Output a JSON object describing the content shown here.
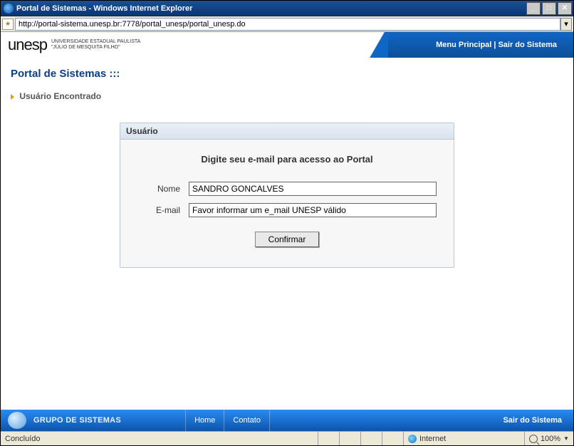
{
  "window": {
    "title": "Portal de Sistemas - Windows Internet Explorer",
    "url": "http://portal-sistema.unesp.br:7778/portal_unesp/portal_unesp.do"
  },
  "header": {
    "logo_text": "unesp",
    "logo_sub_line1": "UNIVERSIDADE ESTADUAL PAULISTA",
    "logo_sub_line2": "\"JÚLIO DE MESQUITA FILHO\"",
    "nav_menu": "Menu Principal",
    "nav_sep": "|",
    "nav_exit": "Sair do Sistema"
  },
  "page": {
    "title": "Portal de Sistemas :::",
    "subtitle": "Usuário Encontrado"
  },
  "panel": {
    "heading": "Usuário",
    "instruction": "Digite seu e-mail para acesso ao Portal",
    "name_label": "Nome",
    "name_value": "SANDRO GONCALVES",
    "email_label": "E-mail",
    "email_value": "Favor informar um e_mail UNESP válido",
    "confirm_label": "Confirmar"
  },
  "footer": {
    "group": "GRUPO DE SISTEMAS",
    "home": "Home",
    "contato": "Contato",
    "exit": "Sair do Sistema"
  },
  "status": {
    "done": "Concluído",
    "zone": "Internet",
    "zoom": "100%",
    "zoom_sep": "▼"
  }
}
